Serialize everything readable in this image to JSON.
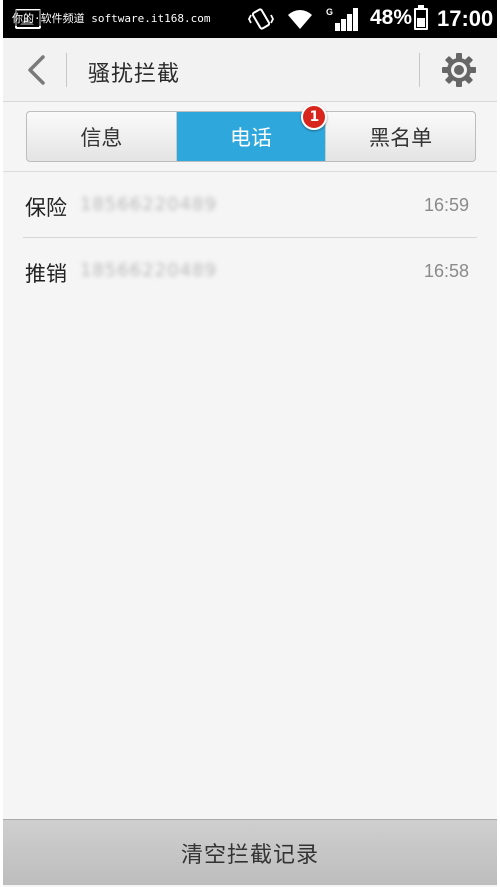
{
  "status_bar": {
    "watermark": "你的·软件频道 software.it168.com",
    "battery_percent": "48%",
    "battery_level": 0.48,
    "time": "17:00",
    "network_type": "G",
    "icons": [
      "image-icon",
      "vibrate-icon",
      "wifi-icon",
      "signal-icon",
      "battery-icon"
    ]
  },
  "header": {
    "title": "骚扰拦截",
    "back_icon": "chevron-left-icon",
    "settings_icon": "gear-icon"
  },
  "tabs": [
    {
      "label": "信息",
      "active": false
    },
    {
      "label": "电话",
      "active": true,
      "badge": "1"
    },
    {
      "label": "黑名单",
      "active": false
    }
  ],
  "calls": [
    {
      "tag": "保险",
      "number": "18566220489",
      "time": "16:59"
    },
    {
      "tag": "推销",
      "number": "18566220489",
      "time": "16:58"
    }
  ],
  "footer": {
    "clear_label": "清空拦截记录"
  },
  "colors": {
    "accent": "#2ea7dc",
    "badge": "#d8261c",
    "status_bar": "#000000",
    "background": "#f5f5f5"
  }
}
